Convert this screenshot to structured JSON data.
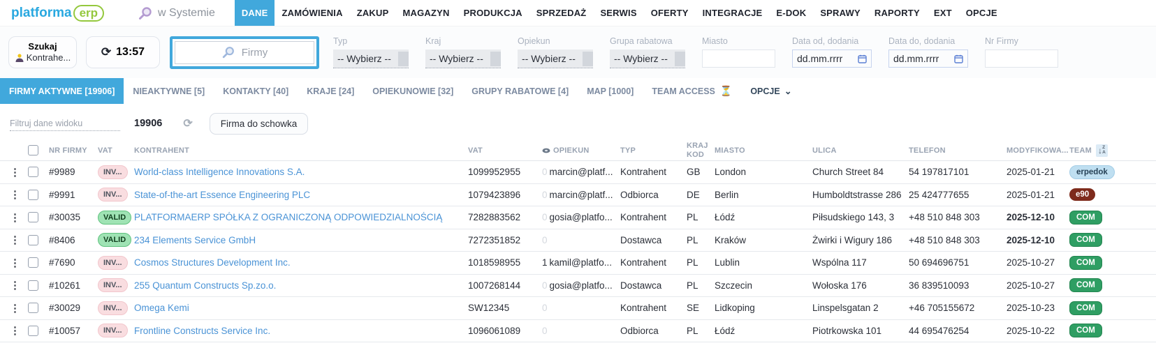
{
  "brand": {
    "name_primary": "platforma",
    "name_secondary": "erp"
  },
  "icons": {
    "kebab": "⋮",
    "refresh": "⟳",
    "hourglass": "⏳",
    "chevron_down": "⌄"
  },
  "topnav": {
    "system_search_label": "w Systemie",
    "items": [
      {
        "label": "DANE",
        "active": true
      },
      {
        "label": "ZAMÓWIENIA"
      },
      {
        "label": "ZAKUP"
      },
      {
        "label": "MAGAZYN"
      },
      {
        "label": "PRODUKCJA"
      },
      {
        "label": "SPRZEDAŻ"
      },
      {
        "label": "SERWIS"
      },
      {
        "label": "OFERTY"
      },
      {
        "label": "INTEGRACJE"
      },
      {
        "label": "E-DOK"
      },
      {
        "label": "SPRAWY"
      },
      {
        "label": "RAPORTY"
      },
      {
        "label": "EXT"
      },
      {
        "label": "OPCJE"
      }
    ]
  },
  "toolbar": {
    "search_contractor_line1": "Szukaj",
    "search_contractor_line2": "Kontrahe...",
    "refresh_time": "13:57",
    "main_search_placeholder": "Firmy",
    "filters": [
      {
        "label": "Typ",
        "type": "select",
        "value": "-- Wybierz --"
      },
      {
        "label": "Kraj",
        "type": "select",
        "value": "-- Wybierz --"
      },
      {
        "label": "Opiekun",
        "type": "select",
        "value": "-- Wybierz --"
      },
      {
        "label": "Grupa rabatowa",
        "type": "select",
        "value": "-- Wybierz --"
      },
      {
        "label": "Miasto",
        "type": "text",
        "value": ""
      },
      {
        "label": "Data od, dodania",
        "type": "date",
        "value": "dd.mm.rrrr"
      },
      {
        "label": "Data do, dodania",
        "type": "date",
        "value": "dd.mm.rrrr"
      },
      {
        "label": "Nr Firmy",
        "type": "text",
        "value": ""
      }
    ]
  },
  "tabs": {
    "items": [
      {
        "label": "FIRMY AKTYWNE [19906]",
        "active": true
      },
      {
        "label": "NIEAKTYWNE [5]"
      },
      {
        "label": "KONTAKTY [40]"
      },
      {
        "label": "KRAJE [24]"
      },
      {
        "label": "OPIEKUNOWIE [32]"
      },
      {
        "label": "GRUPY RABATOWE [4]"
      },
      {
        "label": "MAP [1000]"
      },
      {
        "label": "TEAM ACCESS",
        "hourglass": true
      },
      {
        "label": "OPCJE",
        "dark": true,
        "chevron": true
      }
    ]
  },
  "actions": {
    "filter_placeholder": "Filtruj dane widoku",
    "record_count": "19906",
    "clipboard_button": "Firma do schowka"
  },
  "table": {
    "headers": {
      "nr": "NR FIRMY",
      "vat_status": "VAT",
      "kontrahent": "KONTRAHENT",
      "vat": "VAT",
      "opiekun": "OPIEKUN",
      "typ": "TYP",
      "kraj_kod": "KRAJ\nKOD",
      "miasto": "MIASTO",
      "ulica": "ULICA",
      "telefon": "TELEFON",
      "modyfikowany": "MODYFIKOWA...",
      "team": "TEAM"
    },
    "sort_letters": [
      "Z",
      "A"
    ],
    "sort_arrow": "↓",
    "rows": [
      {
        "nr": "#9989",
        "vat_class": "inv",
        "vat_status": "INV...",
        "name": "World-class Intelligence Innovations S.A.",
        "vat": "1099952955",
        "cnt": "0",
        "cnt_strong": false,
        "opiekun": "marcin@platf...",
        "typ": "Kontrahent",
        "kod": "GB",
        "miasto": "London",
        "ulica": "Church Street 84",
        "telefon": "54 197817101",
        "mod": "2025-01-21",
        "mod_bold": false,
        "team": "erpedok",
        "team_class": "team-blue"
      },
      {
        "nr": "#9991",
        "vat_class": "inv",
        "vat_status": "INV...",
        "name": "State-of-the-art Essence Engineering PLC",
        "vat": "1079423896",
        "cnt": "0",
        "cnt_strong": false,
        "opiekun": "marcin@platf...",
        "typ": "Odbiorca",
        "kod": "DE",
        "miasto": "Berlin",
        "ulica": "Humboldtstrasse 286",
        "telefon": "25 424777655",
        "mod": "2025-01-21",
        "mod_bold": false,
        "team": "e90",
        "team_class": "team-maroon"
      },
      {
        "nr": "#30035",
        "vat_class": "valid",
        "vat_status": "VALID",
        "name": "PLATFORMAERP SPÓŁKA Z OGRANICZONĄ ODPOWIEDZIALNOŚCIĄ",
        "vat": "7282883562",
        "cnt": "0",
        "cnt_strong": false,
        "opiekun": "gosia@platfo...",
        "typ": "Kontrahent",
        "kod": "PL",
        "miasto": "Łódź",
        "ulica": "Piłsudskiego 143, 3",
        "telefon": "+48 510 848 303",
        "mod": "2025-12-10",
        "mod_bold": true,
        "team": "COM",
        "team_class": "team-green"
      },
      {
        "nr": "#8406",
        "vat_class": "valid",
        "vat_status": "VALID",
        "name": "234 Elements Service GmbH",
        "vat": "7272351852",
        "cnt": "0",
        "cnt_strong": false,
        "opiekun": "",
        "typ": "Dostawca",
        "kod": "PL",
        "miasto": "Kraków",
        "ulica": "Żwirki i Wigury 186",
        "telefon": "+48 510 848 303",
        "mod": "2025-12-10",
        "mod_bold": true,
        "team": "COM",
        "team_class": "team-green"
      },
      {
        "nr": "#7690",
        "vat_class": "inv",
        "vat_status": "INV...",
        "name": "Cosmos Structures Development Inc.",
        "vat": "1018598955",
        "cnt": "1",
        "cnt_strong": true,
        "opiekun": "kamil@platfo...",
        "typ": "Kontrahent",
        "kod": "PL",
        "miasto": "Lublin",
        "ulica": "Wspólna 117",
        "telefon": "50 694696751",
        "mod": "2025-10-27",
        "mod_bold": false,
        "team": "COM",
        "team_class": "team-green"
      },
      {
        "nr": "#10261",
        "vat_class": "inv",
        "vat_status": "INV...",
        "name": "255 Quantum Constructs Sp.zo.o.",
        "vat": "1007268144",
        "cnt": "0",
        "cnt_strong": false,
        "opiekun": "gosia@platfo...",
        "typ": "Dostawca",
        "kod": "PL",
        "miasto": "Szczecin",
        "ulica": "Wołoska 176",
        "telefon": "36 839510093",
        "mod": "2025-10-27",
        "mod_bold": false,
        "team": "COM",
        "team_class": "team-green"
      },
      {
        "nr": "#30029",
        "vat_class": "inv",
        "vat_status": "INV...",
        "name": "Omega Kemi",
        "vat": "SW12345",
        "cnt": "0",
        "cnt_strong": false,
        "opiekun": "",
        "typ": "Kontrahent",
        "kod": "SE",
        "miasto": "Lidkoping",
        "ulica": "Linspelsgatan 2",
        "telefon": "+46 705155672",
        "mod": "2025-10-23",
        "mod_bold": false,
        "team": "COM",
        "team_class": "team-green"
      },
      {
        "nr": "#10057",
        "vat_class": "inv",
        "vat_status": "INV...",
        "name": "Frontline Constructs Service Inc.",
        "vat": "1096061089",
        "cnt": "0",
        "cnt_strong": false,
        "opiekun": "",
        "typ": "Odbiorca",
        "kod": "PL",
        "miasto": "Łódź",
        "ulica": "Piotrkowska 101",
        "telefon": "44 695476254",
        "mod": "2025-10-22",
        "mod_bold": false,
        "team": "COM",
        "team_class": "team-green"
      }
    ]
  }
}
